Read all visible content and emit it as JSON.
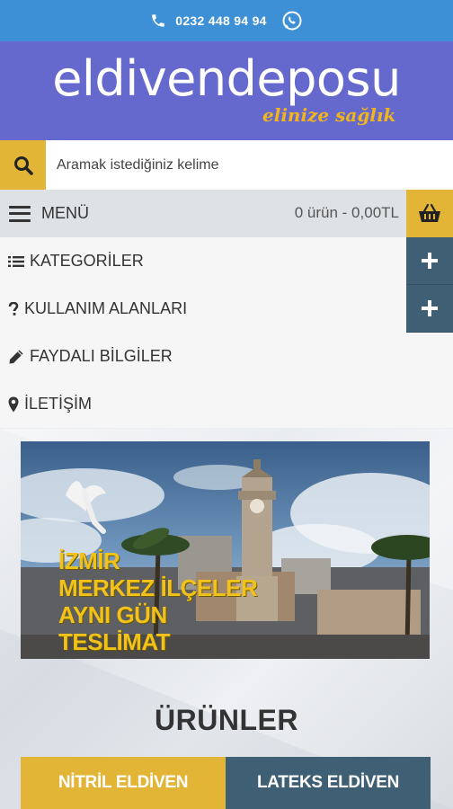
{
  "topbar": {
    "phone_icon": "phone-icon",
    "phone_number": "0232 448 94 94",
    "whatsapp_icon": "whatsapp-icon"
  },
  "header": {
    "logo": "eldivendeposu",
    "tagline": "elinize sağlık"
  },
  "search": {
    "placeholder": "Aramak istediğiniz kelime",
    "icon": "search-icon"
  },
  "menubar": {
    "menu_label": "MENÜ",
    "cart_summary": "0 ürün - 0,00TL",
    "cart_icon": "basket-icon"
  },
  "nav": {
    "items": [
      {
        "label": "KATEGORİLER",
        "icon": "list-icon",
        "expandable": true
      },
      {
        "label": "KULLANIM ALANLARI",
        "icon": "question-icon",
        "expandable": true
      },
      {
        "label": "FAYDALI BİLGİLER",
        "icon": "pencil-icon",
        "expandable": false
      },
      {
        "label": "İLETİŞİM",
        "icon": "map-marker-icon",
        "expandable": false
      }
    ]
  },
  "banner": {
    "lines": [
      "İZMİR",
      "MERKEZ İLÇELER",
      "AYNI GÜN",
      "TESLİMAT"
    ]
  },
  "products": {
    "title": "ÜRÜNLER",
    "tabs": [
      {
        "label": "NİTRİL ELDİVEN",
        "active": true
      },
      {
        "label": "LATEKS ELDİVEN",
        "active": false
      }
    ]
  },
  "colors": {
    "topbar": "#3d8fd6",
    "header": "#6569cd",
    "accent_gold": "#e2b537",
    "slate": "#3f5f74"
  }
}
